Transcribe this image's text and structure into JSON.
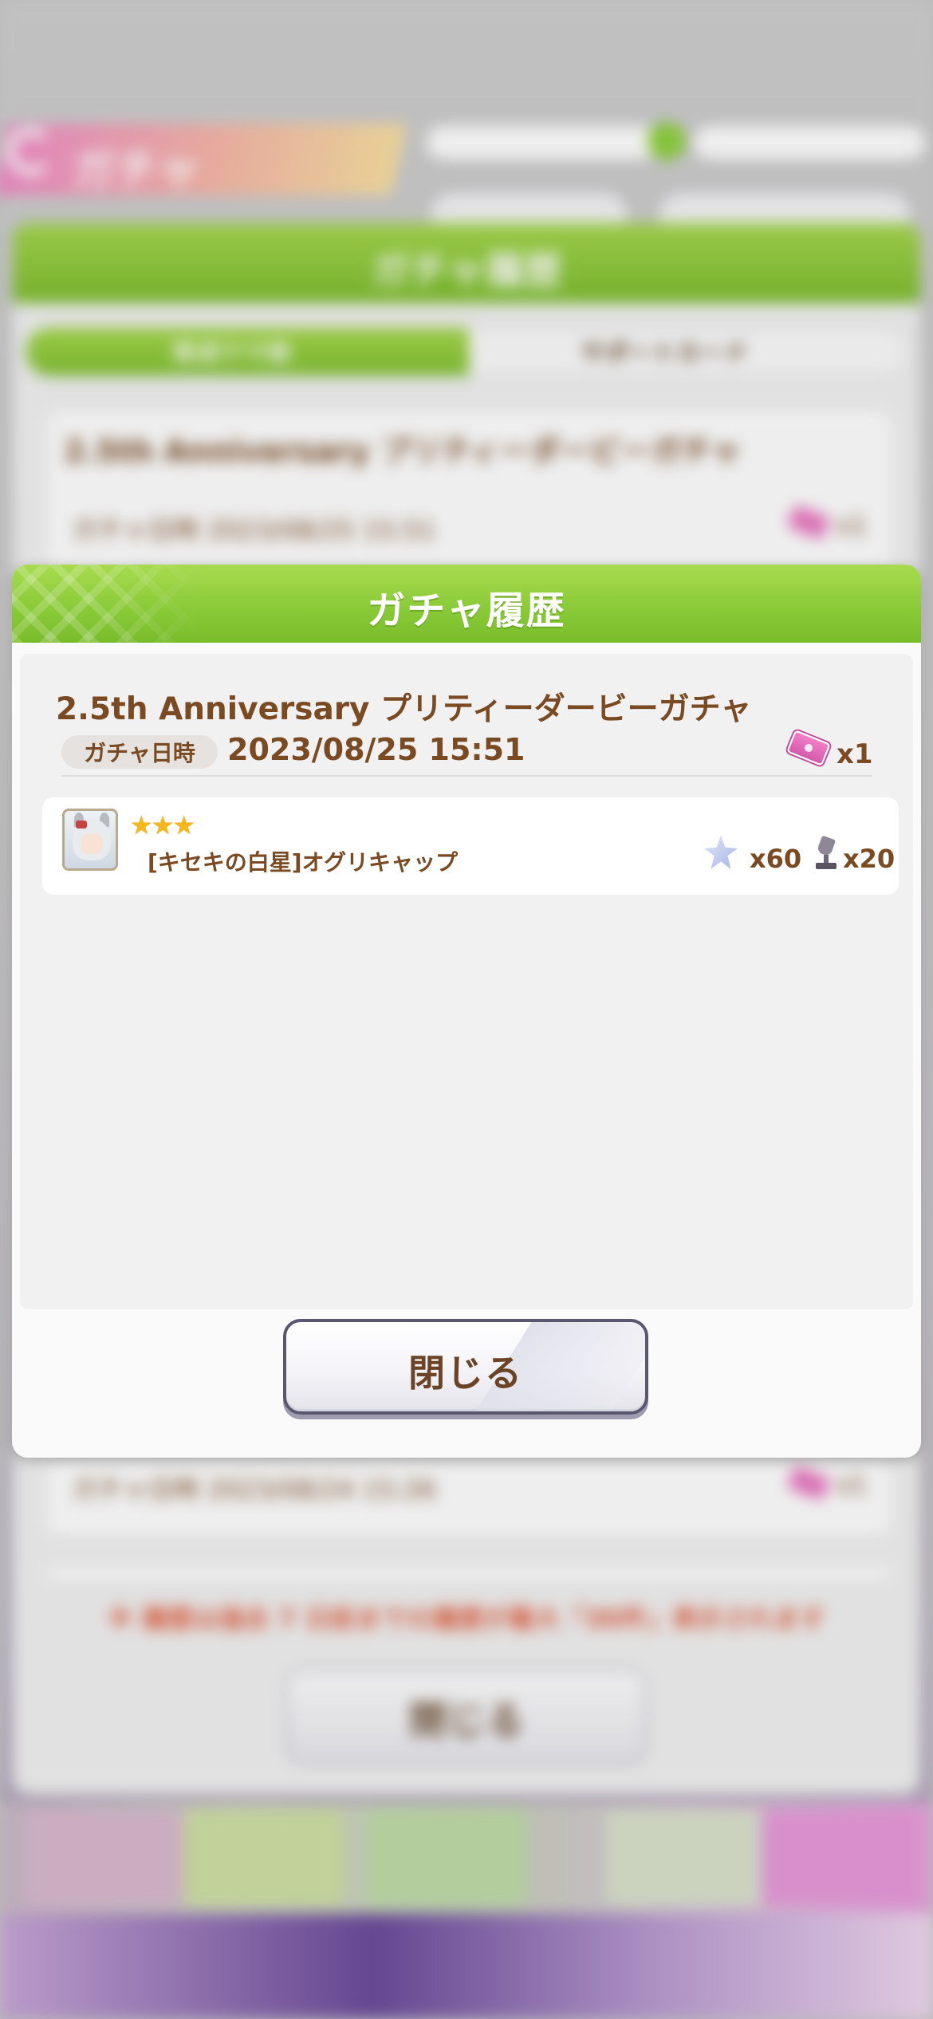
{
  "background": {
    "header_title": "ガチャ",
    "panel_title": "ガチャ履歴",
    "tabs": [
      "育成ウマ娘",
      "サポートカード"
    ],
    "entries": [
      {
        "title": "2.5th Anniversary プリティーダービーガチャ",
        "date": "ガチャ日時 2023/08/25 15:51",
        "count": "x1"
      },
      {
        "title": "",
        "date": "ガチャ日時 2023/08/24 15:26",
        "count": "x1"
      }
    ],
    "note": "※ 履歴は過去 7 日前までの履歴が最大「30件」表示されます",
    "close_label": "閉じる"
  },
  "modal": {
    "title": "ガチャ履歴",
    "gacha_name": "2.5th Anniversary プリティーダービーガチャ",
    "date_label": "ガチャ日時",
    "date_value": "2023/08/25 15:51",
    "ticket_count": "x1",
    "result": {
      "stars": "★★★",
      "rarity": 3,
      "name": "[キセキの白星]オグリキャップ",
      "piece_count": "x60",
      "trophy_count": "x20"
    },
    "close_label": "閉じる"
  },
  "colors": {
    "header_green": "#88c936",
    "text_brown": "#7a4a22",
    "star_gold": "#f2b81c",
    "ticket_pink": "#f27fc8"
  }
}
